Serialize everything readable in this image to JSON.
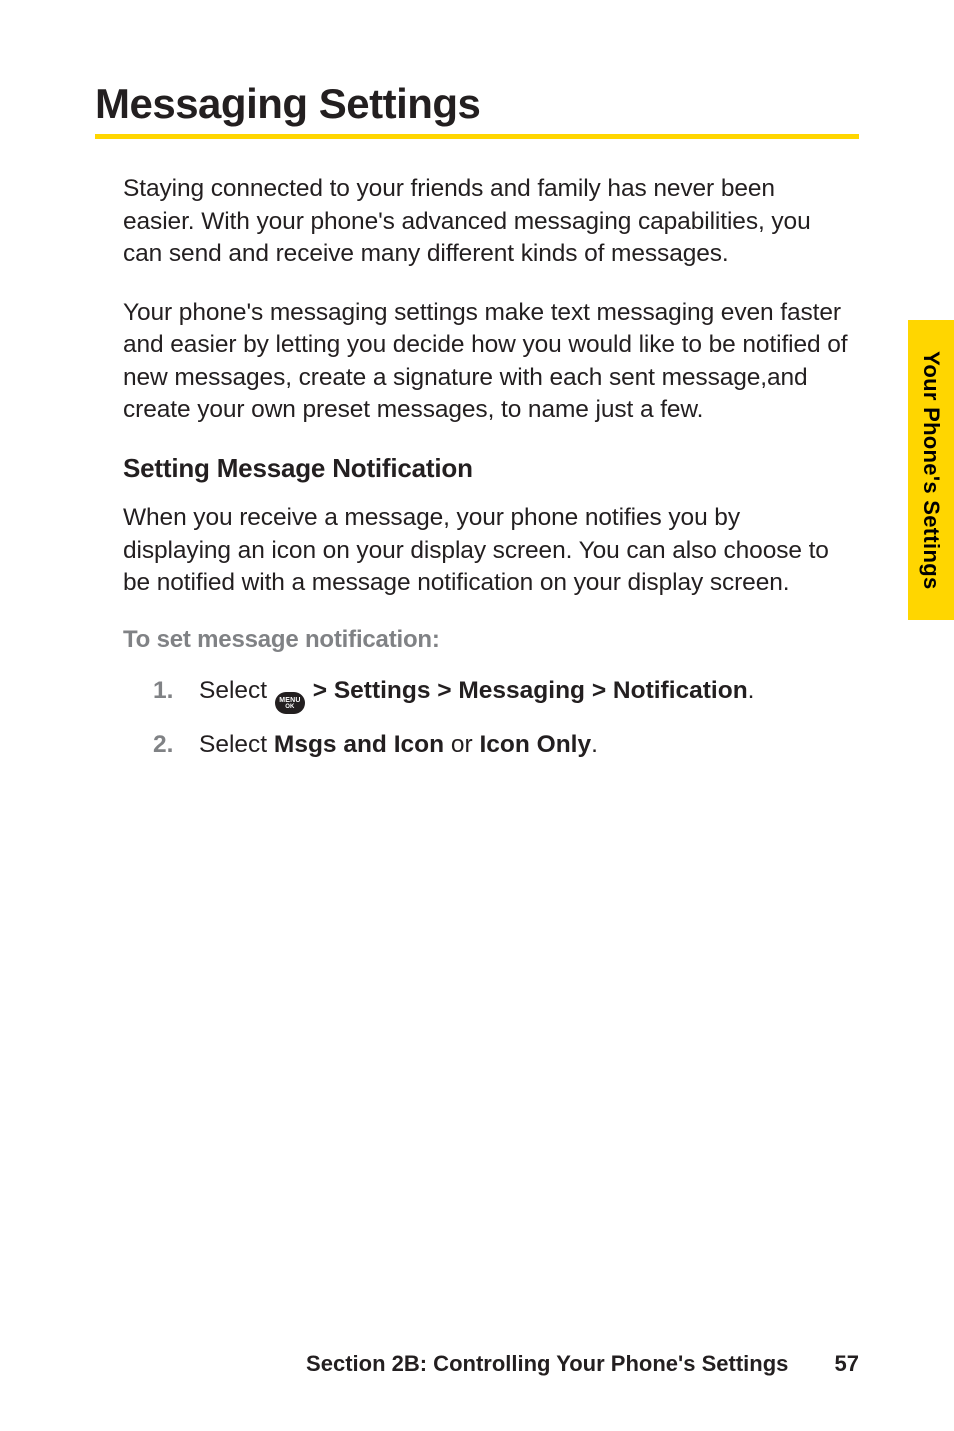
{
  "sideTab": "Your Phone's Settings",
  "title": "Messaging Settings",
  "para1": "Staying connected to your friends and family has never been easier. With your phone's advanced messaging capabilities, you can send and receive many different kinds of messages.",
  "para2": "Your phone's messaging settings make text messaging even faster and easier by letting you decide how you would like to be notified of new messages, create a signature with each sent message,and create your own preset messages, to name just a few.",
  "subhead": "Setting Message Notification",
  "para3": "When you receive a message, your phone notifies you by displaying an icon on your display screen. You can also choose to be notified with a message notification on your display screen.",
  "grayLead": "To set message notification:",
  "steps": {
    "s1": {
      "num": "1.",
      "pre": "Select ",
      "iconTop": "MENU",
      "iconBottom": "OK",
      "path": " > Settings > Messaging > Notification",
      "end": "."
    },
    "s2": {
      "num": "2.",
      "pre": "Select ",
      "opt1": "Msgs and Icon",
      "mid": " or ",
      "opt2": "Icon Only",
      "end": "."
    }
  },
  "footer": {
    "section": "Section 2B: Controlling Your Phone's Settings",
    "page": "57"
  }
}
